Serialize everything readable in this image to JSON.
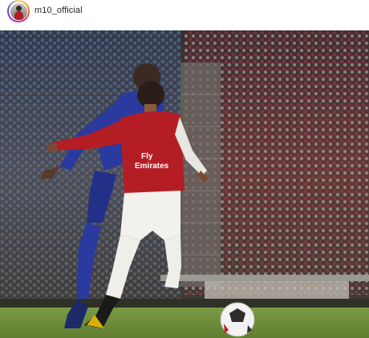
{
  "post": {
    "username": "m10_official"
  },
  "icons": {
    "avatar": "profile-photo",
    "main_image": "football-match-photo"
  },
  "colors": {
    "text": "#262626",
    "arsenal_red": "#b51d24",
    "chelsea_blue": "#2a3a9e",
    "pitch": "#6f8f3c"
  }
}
